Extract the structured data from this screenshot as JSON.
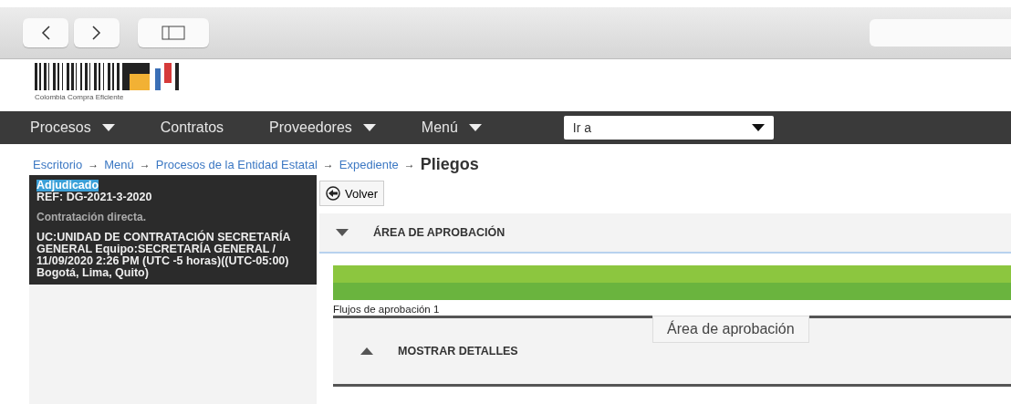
{
  "logo": {
    "caption": "Colombia Compra Eficiente"
  },
  "nav": {
    "items": [
      {
        "label": "Procesos",
        "dropdown": true
      },
      {
        "label": "Contratos",
        "dropdown": false
      },
      {
        "label": "Proveedores",
        "dropdown": true
      },
      {
        "label": "Menú",
        "dropdown": true
      }
    ],
    "goto": {
      "value": "Ir a"
    }
  },
  "breadcrumb": {
    "links": [
      "Escritorio",
      "Menú",
      "Procesos de la Entidad Estatal",
      "Expediente"
    ],
    "separator": "→",
    "current": "Pliegos"
  },
  "sidebar": {
    "status": "Adjudicado",
    "ref": "REF: DG-2021-3-2020",
    "type": "Contratación directa.",
    "details": "UC:UNIDAD DE CONTRATACIÓN SECRETARÍA GENERAL Equipo:SECRETARÍA GENERAL / 11/09/2020 2:26 PM (UTC -5 horas)((UTC-05:00) Bogotá, Lima, Quito)"
  },
  "back_button": {
    "label": "Volver"
  },
  "section": {
    "title": "ÁREA DE APROBACIÓN",
    "expanded": true,
    "progress": {
      "level": 1
    },
    "flow_label": "Flujos de aprobación 1",
    "tooltip": "Área de aprobación",
    "details": {
      "title": "MOSTRAR DETALLES",
      "expanded": false
    }
  }
}
